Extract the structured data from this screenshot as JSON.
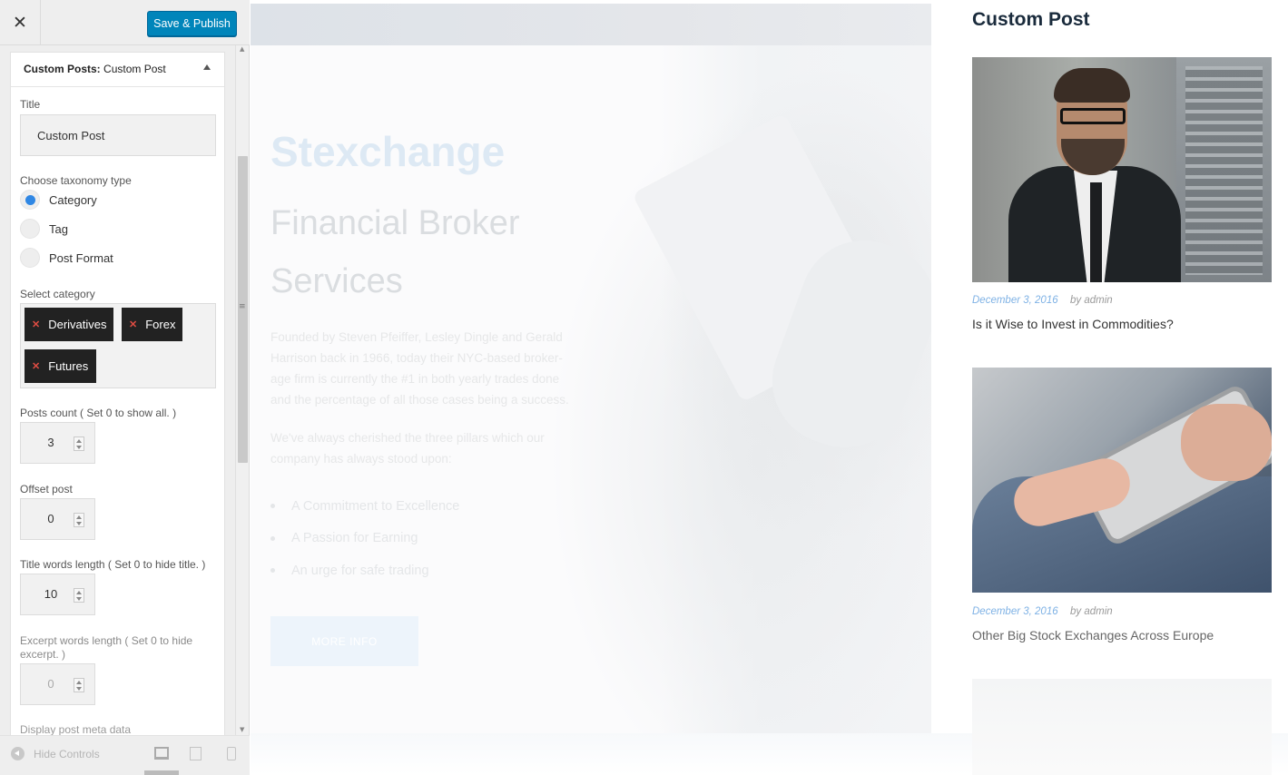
{
  "header": {
    "close_icon": "close-icon",
    "publish_label": "Save & Publish"
  },
  "section": {
    "title_bold": "Custom Posts:",
    "title_rest": " Custom Post"
  },
  "form": {
    "title_label": "Title",
    "title_value": "Custom Post",
    "taxonomy_label": "Choose taxonomy type",
    "taxonomy_options": [
      {
        "label": "Category",
        "checked": true
      },
      {
        "label": "Tag",
        "checked": false
      },
      {
        "label": "Post Format",
        "checked": false
      }
    ],
    "category_label": "Select category",
    "categories": [
      "Derivatives",
      "Forex",
      "Futures"
    ],
    "posts_count_label": "Posts count ( Set 0 to show all. )",
    "posts_count": "3",
    "offset_label": "Offset post",
    "offset": "0",
    "title_words_label": "Title words length ( Set 0 to hide title. )",
    "title_words": "10",
    "excerpt_label": "Excerpt words length ( Set 0 to hide excerpt. )",
    "excerpt_words": "0",
    "meta_label": "Display post meta data"
  },
  "footer": {
    "hide_controls": "Hide Controls"
  },
  "hero": {
    "brand": "Stexchange",
    "heading": "Financial Broker Services",
    "paragraph1": "Founded by Steven Pfeiffer, Lesley Dingle and Gerald Harrison back in 1966, today their NYC-based broker-age firm is currently the #1 in both yearly trades done and the percentage of all those cases being a success.",
    "paragraph2": "We've always cherished the three pillars which our company has always stood upon:",
    "pillars": [
      "A Commitment to Excellence",
      "A Passion for Earning",
      "An urge for safe trading"
    ],
    "button": "MORE INFO"
  },
  "widget": {
    "title": "Custom Post",
    "posts": [
      {
        "date": "December 3, 2016",
        "author": "by admin",
        "title": "Is it Wise to Invest in Commodities?"
      },
      {
        "date": "December 3, 2016",
        "author": "by admin",
        "title": "Other Big Stock Exchanges Across Europe"
      }
    ]
  },
  "colors": {
    "primary_button": "#0085ba",
    "chip_bg": "#222222",
    "radio_active": "#2f87e4",
    "date_accent": "#7fb2e5"
  }
}
